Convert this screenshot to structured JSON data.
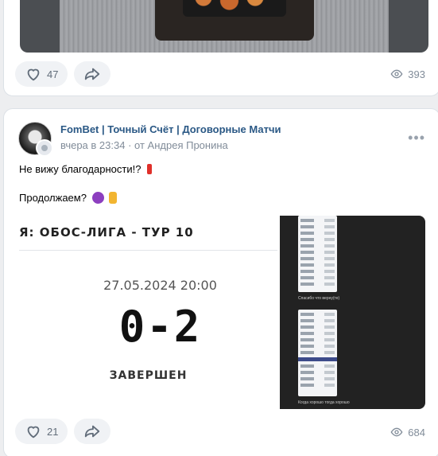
{
  "post1": {
    "likes": "47",
    "views": "393"
  },
  "post2": {
    "author": "FomBet | Точный Счёт | Договорные Матчи",
    "time": "вчера в 23:34",
    "meta_sep": "·",
    "by": "от Андрея Пронина",
    "more": "•••",
    "line1": "Не вижу благодарности!?",
    "line2": "Продолжаем?",
    "scoreboard": {
      "league": "Я: ОБОС-ЛИГА - ТУР 10",
      "date": "27.05.2024 20:00",
      "score": "0-2",
      "status": "ЗАВЕРШЕН"
    },
    "screens": {
      "caption1": "Спасибо что верну(те)",
      "caption2": "Когда хорошо тогда хорошо"
    },
    "likes": "21",
    "views": "684"
  },
  "colors": {
    "author_link": "#2a5885",
    "action_bg": "#f0f2f5",
    "muted": "#818c99"
  },
  "icons": [
    "heart-icon",
    "share-icon",
    "eye-icon",
    "more-icon",
    "avatar-badge-icon"
  ]
}
